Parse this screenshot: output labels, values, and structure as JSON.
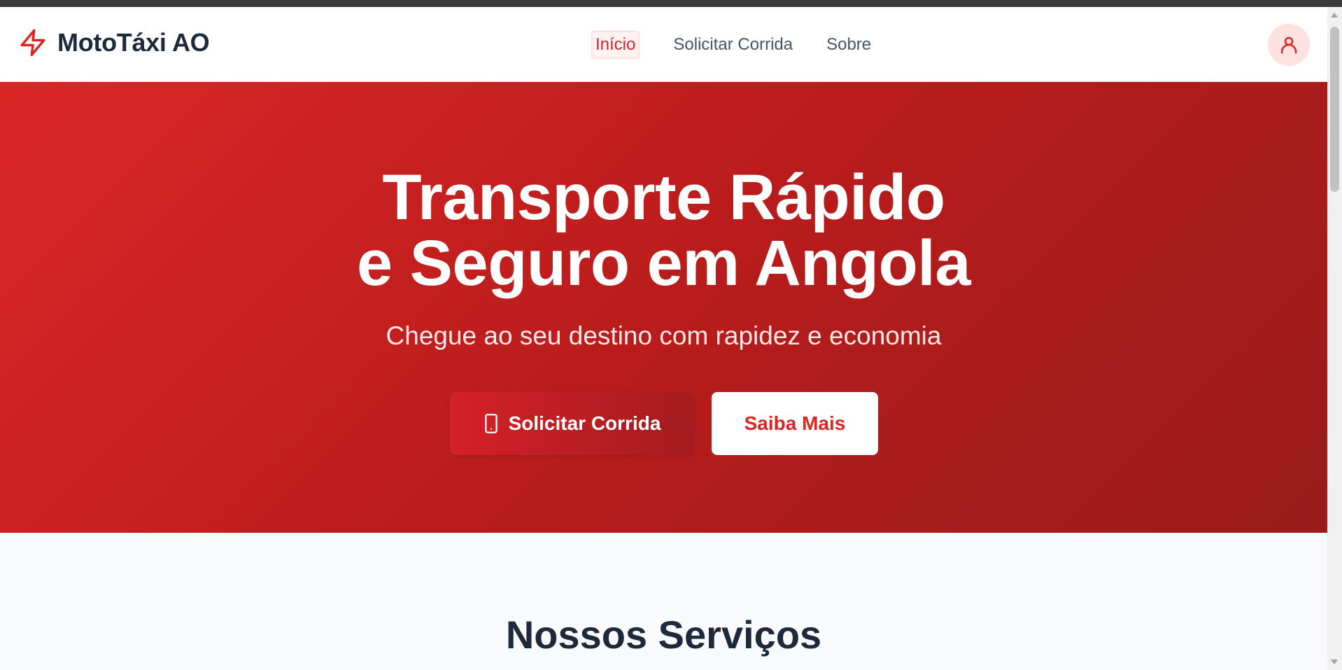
{
  "brand": {
    "name": "MotoTáxi AO",
    "accent": "#dc2626"
  },
  "nav": {
    "items": [
      {
        "label": "Início",
        "active": true
      },
      {
        "label": "Solicitar Corrida",
        "active": false
      },
      {
        "label": "Sobre",
        "active": false
      }
    ]
  },
  "user": {
    "icon": "user-icon"
  },
  "hero": {
    "title_line1": "Transporte Rápido",
    "title_line2": "e Seguro em Angola",
    "subtitle": "Chegue ao seu destino com rapidez e economia",
    "primary_button": {
      "label": "Solicitar Corrida",
      "icon": "smartphone-icon"
    },
    "secondary_button": {
      "label": "Saiba Mais"
    }
  },
  "services": {
    "title": "Nossos Serviços"
  }
}
